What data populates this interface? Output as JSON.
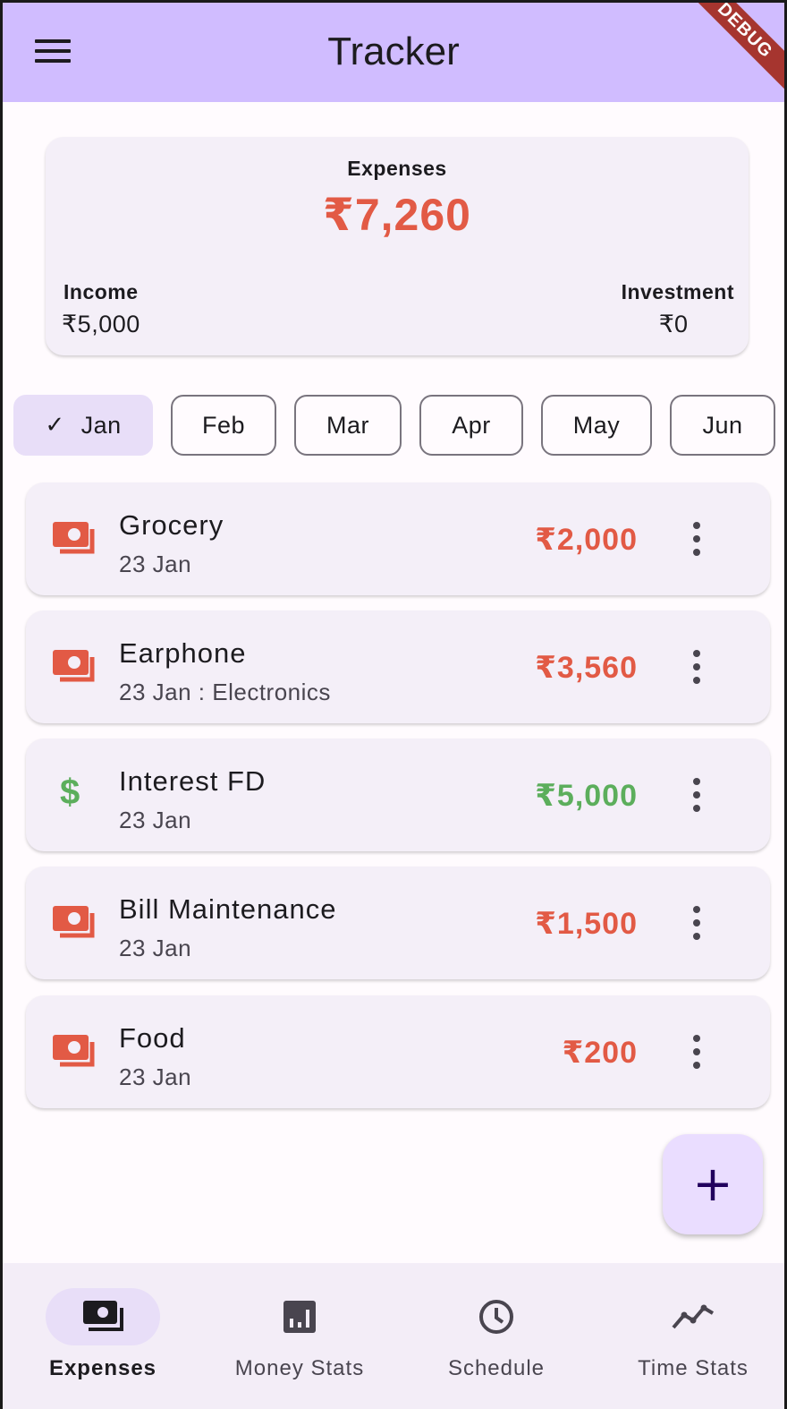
{
  "appbar": {
    "title": "Tracker",
    "debug": "DEBUG"
  },
  "summary": {
    "expenses_label": "Expenses",
    "expenses_value": "₹7,260",
    "income_label": "Income",
    "income_value": "₹5,000",
    "investment_label": "Investment",
    "investment_value": "₹0"
  },
  "months": [
    {
      "label": "Jan",
      "selected": true
    },
    {
      "label": "Feb",
      "selected": false
    },
    {
      "label": "Mar",
      "selected": false
    },
    {
      "label": "Apr",
      "selected": false
    },
    {
      "label": "May",
      "selected": false
    },
    {
      "label": "Jun",
      "selected": false
    }
  ],
  "transactions": [
    {
      "title": "Grocery",
      "subtitle": "23 Jan",
      "amount": "₹2,000",
      "type": "expense",
      "icon": "payments-icon"
    },
    {
      "title": "Earphone",
      "subtitle": "23 Jan : Electronics",
      "amount": "₹3,560",
      "type": "expense",
      "icon": "payments-icon"
    },
    {
      "title": "Interest FD",
      "subtitle": "23 Jan",
      "amount": "₹5,000",
      "type": "income",
      "icon": "dollar-icon"
    },
    {
      "title": "Bill Maintenance",
      "subtitle": "23 Jan",
      "amount": "₹1,500",
      "type": "expense",
      "icon": "payments-icon"
    },
    {
      "title": "Food",
      "subtitle": "23 Jan",
      "amount": "₹200",
      "type": "expense",
      "icon": "payments-icon"
    }
  ],
  "fab": {
    "label": "+"
  },
  "nav": [
    {
      "label": "Expenses",
      "icon": "payments-icon",
      "active": true
    },
    {
      "label": "Money Stats",
      "icon": "bar-chart-icon",
      "active": false
    },
    {
      "label": "Schedule",
      "icon": "clock-icon",
      "active": false
    },
    {
      "label": "Time Stats",
      "icon": "line-chart-icon",
      "active": false
    }
  ],
  "colors": {
    "appbar": "#d0bcff",
    "expense": "#e25a45",
    "income": "#5cae5c",
    "chip_selected": "#e8def8",
    "fab": "#eaddff"
  }
}
